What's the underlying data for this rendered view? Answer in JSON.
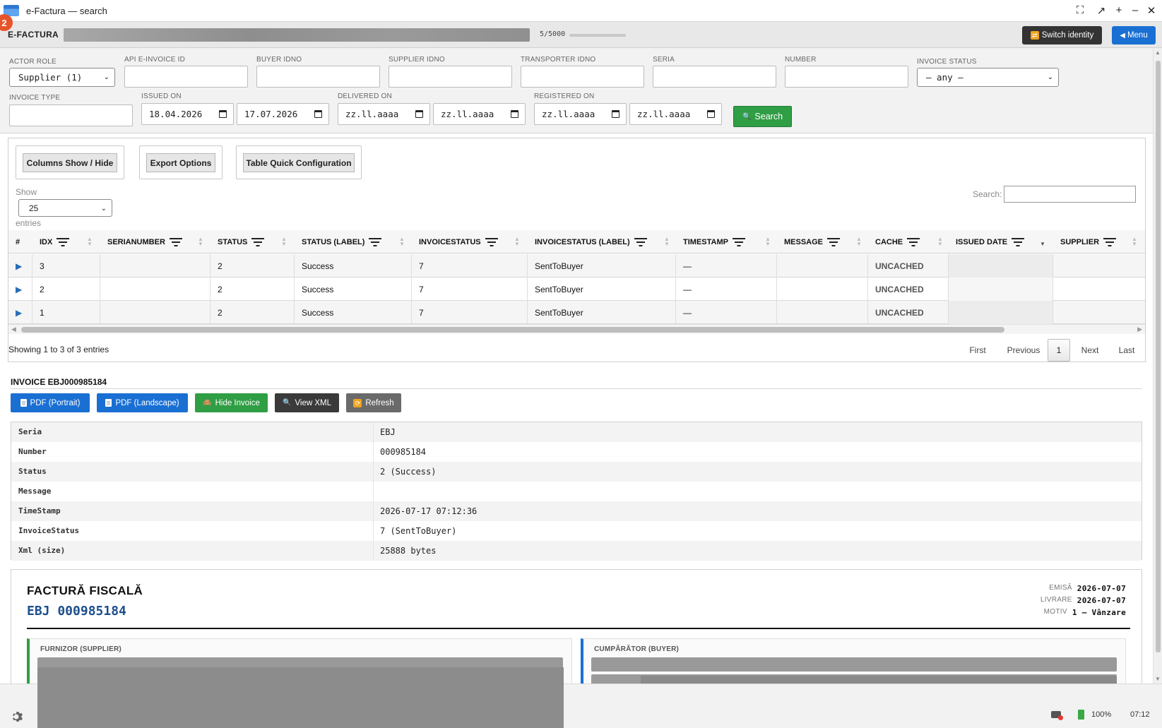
{
  "window": {
    "title": "e-Factura — search",
    "badge": "2"
  },
  "appbar": {
    "brand": "E-FACTURA",
    "counter": "5/5000",
    "switch_label": "Switch identity",
    "menu_label": "Menu"
  },
  "filters": {
    "actor_role": {
      "label": "ACTOR ROLE",
      "value": "Supplier (1)"
    },
    "api_invoice_id": {
      "label": "API E-INVOICE ID",
      "value": ""
    },
    "buyer_idno": {
      "label": "BUYER IDNO",
      "value": ""
    },
    "supplier_idno": {
      "label": "SUPPLIER IDNO",
      "value": ""
    },
    "transporter_idno": {
      "label": "TRANSPORTER IDNO",
      "value": ""
    },
    "seria": {
      "label": "SERIA",
      "value": ""
    },
    "number": {
      "label": "NUMBER",
      "value": ""
    },
    "invoice_status": {
      "label": "INVOICE STATUS",
      "value": "— any —"
    },
    "invoice_type": {
      "label": "INVOICE TYPE",
      "value": ""
    },
    "issued_on": {
      "label": "ISSUED ON",
      "from": "18.04.2026",
      "to": "17.07.2026"
    },
    "delivered_on": {
      "label": "DELIVERED ON",
      "from": "zz.ll.aaaa",
      "to": "zz.ll.aaaa"
    },
    "registered_on": {
      "label": "REGISTERED ON",
      "from": "zz.ll.aaaa",
      "to": "zz.ll.aaaa"
    },
    "search_label": "Search"
  },
  "table": {
    "toolbar": {
      "columns_label": "Columns Show / Hide",
      "export_label": "Export Options",
      "quick_config_label": "Table Quick Configuration"
    },
    "show_label": "Show",
    "page_size": "25",
    "entries_label": "entries",
    "search_label": "Search:",
    "columns": [
      "#",
      "IDX",
      "SERIANUMBER",
      "STATUS",
      "STATUS (LABEL)",
      "INVOICESTATUS",
      "INVOICESTATUS (LABEL)",
      "TIMESTAMP",
      "MESSAGE",
      "CACHE",
      "ISSUED DATE",
      "SUPPLIER"
    ],
    "rows": [
      {
        "idx": "3",
        "serianumber": "",
        "status": "2",
        "status_label": "Success",
        "invoicestatus": "7",
        "invoicestatus_label": "SentToBuyer",
        "timestamp": "—",
        "message": "",
        "cache": "UNCACHED"
      },
      {
        "idx": "2",
        "serianumber": "",
        "status": "2",
        "status_label": "Success",
        "invoicestatus": "7",
        "invoicestatus_label": "SentToBuyer",
        "timestamp": "—",
        "message": "",
        "cache": "UNCACHED"
      },
      {
        "idx": "1",
        "serianumber": "",
        "status": "2",
        "status_label": "Success",
        "invoicestatus": "7",
        "invoicestatus_label": "SentToBuyer",
        "timestamp": "—",
        "message": "",
        "cache": "UNCACHED"
      }
    ],
    "info": "Showing 1 to 3 of 3 entries",
    "pager": {
      "first": "First",
      "previous": "Previous",
      "current": "1",
      "next": "Next",
      "last": "Last"
    }
  },
  "invoice": {
    "title": "INVOICE EBJ000985184",
    "actions": {
      "pdf_portrait": "PDF (Portrait)",
      "pdf_landscape": "PDF (Landscape)",
      "hide": "Hide Invoice",
      "view_xml": "View XML",
      "refresh": "Refresh"
    },
    "details": [
      {
        "key": "Seria",
        "value": "EBJ"
      },
      {
        "key": "Number",
        "value": "000985184"
      },
      {
        "key": "Status",
        "value": "2 (Success)"
      },
      {
        "key": "Message",
        "value": ""
      },
      {
        "key": "TimeStamp",
        "value": "2026-07-17 07:12:36"
      },
      {
        "key": "InvoiceStatus",
        "value": "7 (SentToBuyer)"
      },
      {
        "key": "Xml (size)",
        "value": "25888 bytes"
      }
    ],
    "document": {
      "title": "FACTURĂ FISCALĂ",
      "number": "EBJ 000985184",
      "emisa_label": "EMISĂ",
      "emisa": "2026-07-07",
      "livrare_label": "LIVRARE",
      "livrare": "2026-07-07",
      "motiv_label": "MOTIV",
      "motiv": "1 — Vânzare",
      "supplier_label": "FURNIZOR (SUPPLIER)",
      "buyer_label": "CUMPĂRĂTOR (BUYER)"
    }
  },
  "colors": {
    "primary": "#1a6fd3",
    "success": "#2f9e44",
    "dark": "#333333",
    "supplier_accent": "#2f9e44",
    "buyer_accent": "#1a6fd3"
  },
  "statusbar": {
    "battery": "100%",
    "time": "07:12"
  }
}
